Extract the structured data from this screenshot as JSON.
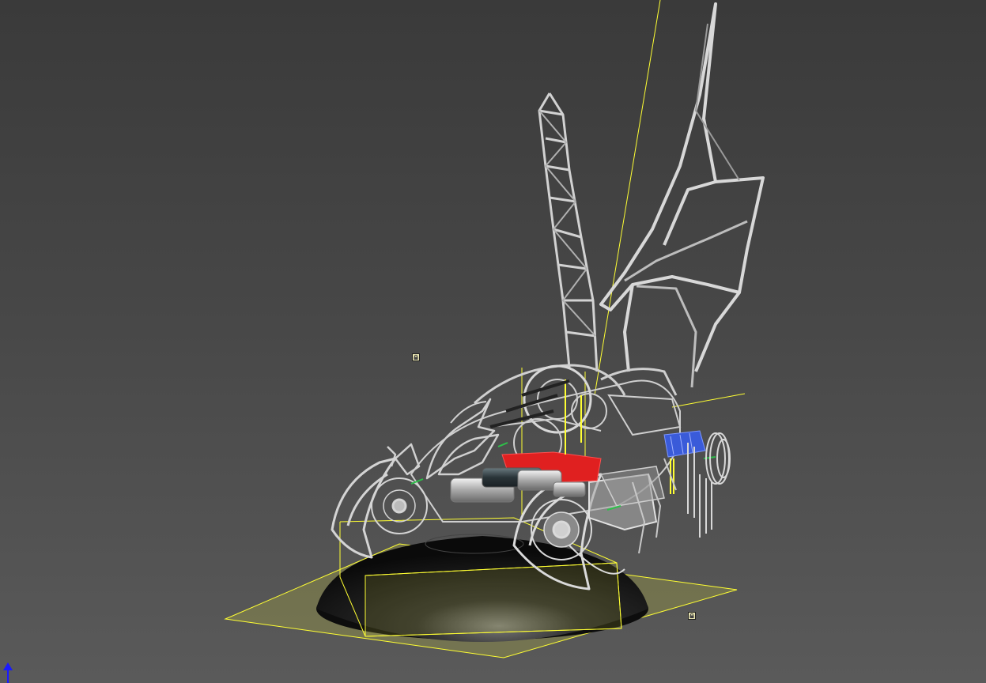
{
  "viewport": {
    "background_top": "#3a3a3a",
    "background_bottom": "#5a5a5a",
    "selection_color": "#ffff33",
    "model_color": "#c8c8c8",
    "accent_red": "#e02020",
    "accent_blue": "#3a5bd9",
    "accent_green": "#2ec04a",
    "axis_color": "#1a1aff"
  },
  "markers": {
    "icon": "lock-icon"
  },
  "axis": {
    "icon": "z-axis-arrow-icon"
  }
}
